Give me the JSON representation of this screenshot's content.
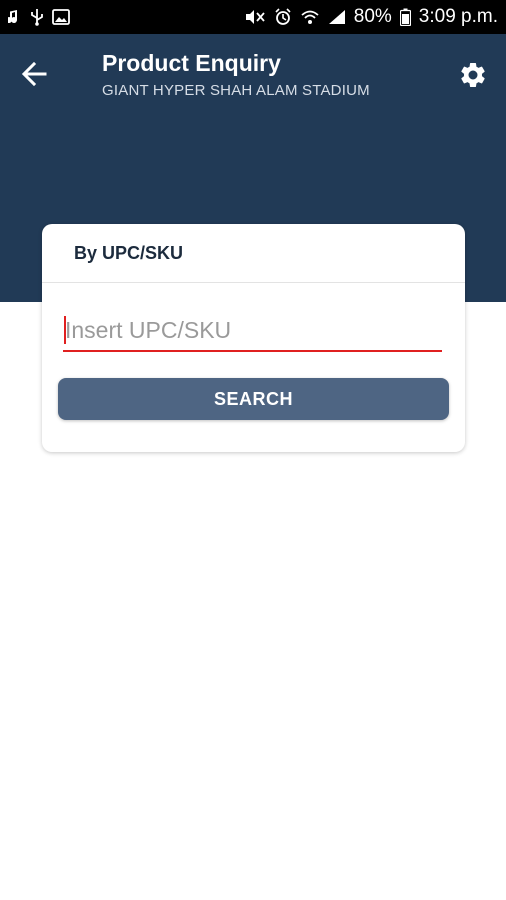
{
  "status_bar": {
    "battery_text": "80%",
    "time": "3:09 p.m.",
    "left_icons": [
      "audio-icon",
      "usb-icon",
      "image-icon"
    ],
    "right_icons": [
      "mute-icon",
      "alarm-icon",
      "wifi-icon",
      "signal-icon",
      "battery-icon"
    ]
  },
  "header": {
    "title": "Product Enquiry",
    "subtitle": "GIANT HYPER SHAH ALAM STADIUM",
    "background_color": "#213a56"
  },
  "card": {
    "title": "By UPC/SKU",
    "input_placeholder": "Insert UPC/SKU",
    "input_value": "",
    "search_label": "SEARCH",
    "button_color": "#4e6583",
    "underline_color": "#e02020"
  }
}
